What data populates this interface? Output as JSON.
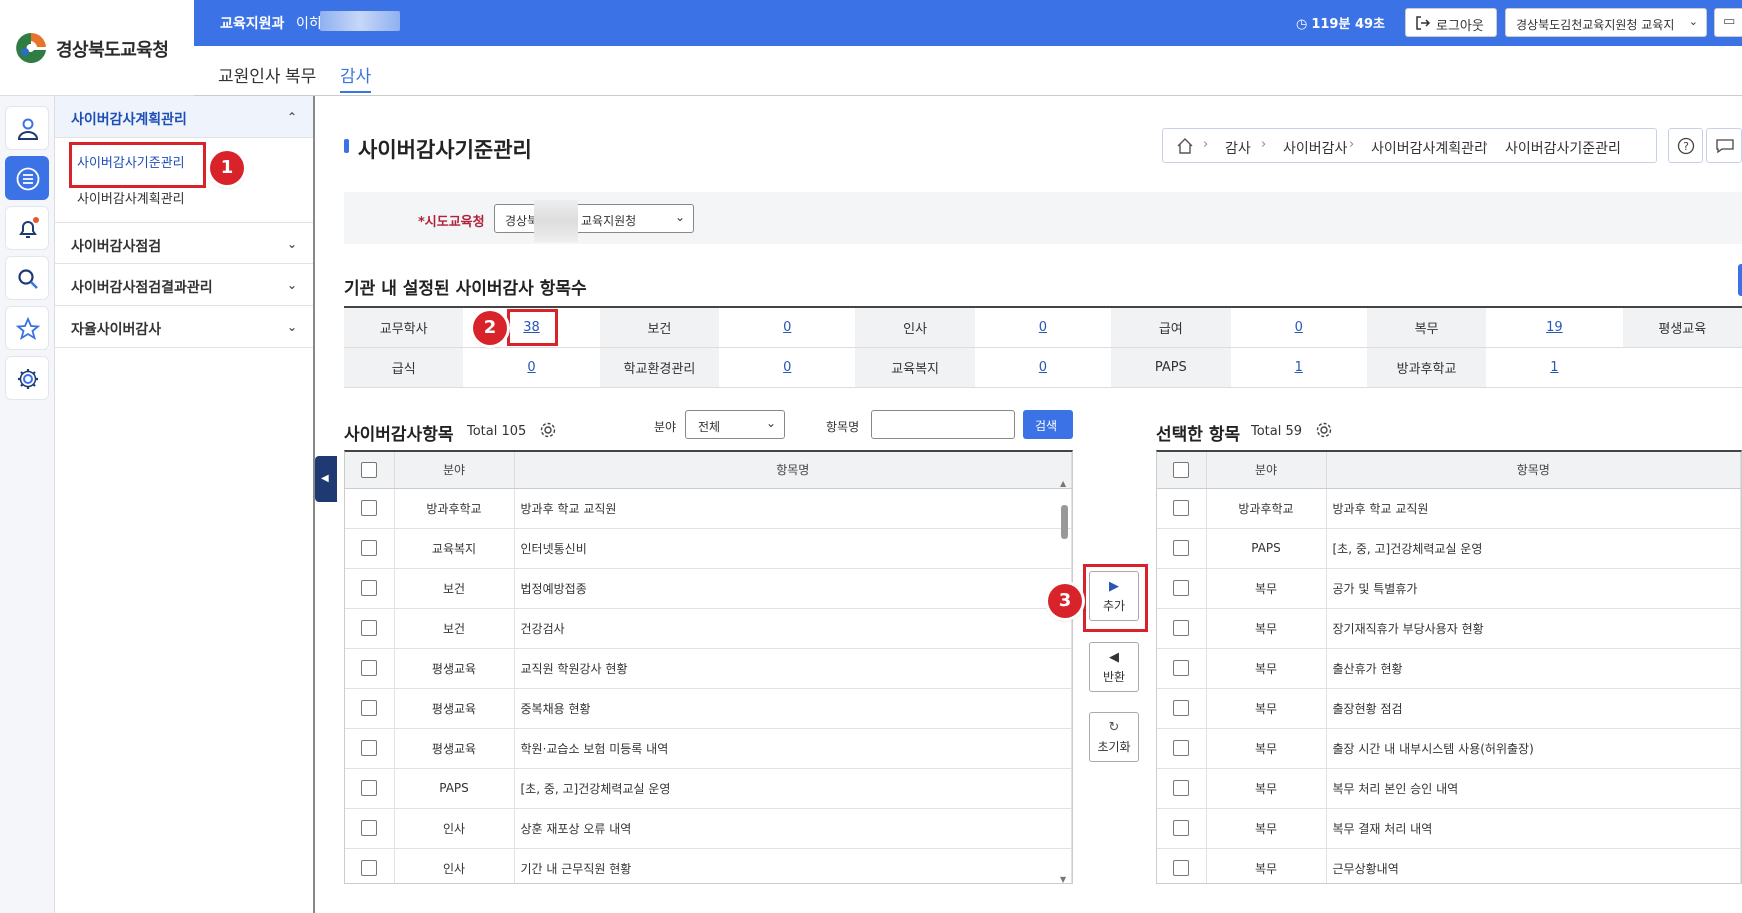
{
  "header": {
    "logo_text": "경상북도교육청",
    "dept": "교육지원과",
    "user_name": "이히",
    "timer": "119분 49초",
    "logout_label": "로그아웃",
    "org_select": "경상북도김천교육지원청 교육지"
  },
  "top_nav": [
    "교원인사",
    "복무",
    "감사"
  ],
  "side_menu": {
    "plan": {
      "label": "사이버감사계획관리",
      "items": [
        "사이버감사기준관리",
        "사이버감사계획관리"
      ]
    },
    "check": {
      "label": "사이버감사점검"
    },
    "result": {
      "label": "사이버감사점검결과관리"
    },
    "self": {
      "label": "자율사이버감사"
    }
  },
  "page": {
    "title": "사이버감사기준관리",
    "breadcrumb": [
      "감사",
      "사이버감사",
      "사이버감사계획관리",
      "사이버감사기준관리"
    ]
  },
  "filter": {
    "label": "*시도교육청",
    "value_left": "경상북",
    "value_right": "교육지원청"
  },
  "summary": {
    "title": "기관 내 설정된 사이버감사 항목수",
    "rows": [
      [
        {
          "k": "교무학사",
          "v": "38"
        },
        {
          "k": "보건",
          "v": "0"
        },
        {
          "k": "인사",
          "v": "0"
        },
        {
          "k": "급여",
          "v": "0"
        },
        {
          "k": "복무",
          "v": "19"
        },
        {
          "k": "평생교육",
          "v": ""
        }
      ],
      [
        {
          "k": "급식",
          "v": "0"
        },
        {
          "k": "학교환경관리",
          "v": "0"
        },
        {
          "k": "교육복지",
          "v": "0"
        },
        {
          "k": "PAPS",
          "v": "1"
        },
        {
          "k": "방과후학교",
          "v": "1"
        },
        {
          "k": "",
          "v": ""
        }
      ]
    ]
  },
  "left_panel": {
    "title": "사이버감사항목",
    "total": "Total 105",
    "field_label": "분야",
    "field_value": "전체",
    "item_label": "항목명",
    "item_value": "",
    "search_label": "검색",
    "col_field": "분야",
    "col_name": "항목명",
    "rows": [
      {
        "field": "방과후학교",
        "name": "방과후 학교 교직원"
      },
      {
        "field": "교육복지",
        "name": "인터넷통신비"
      },
      {
        "field": "보건",
        "name": "법정예방접종"
      },
      {
        "field": "보건",
        "name": "건강검사"
      },
      {
        "field": "평생교육",
        "name": "교직원 학원강사 현황"
      },
      {
        "field": "평생교육",
        "name": "중복채용 현황"
      },
      {
        "field": "평생교육",
        "name": "학원·교습소 보험 미등록 내역"
      },
      {
        "field": "PAPS",
        "name": "[초, 중, 고]건강체력교실 운영"
      },
      {
        "field": "인사",
        "name": "상훈 재포상 오류 내역"
      },
      {
        "field": "인사",
        "name": "기간 내 근무직원 현황"
      }
    ]
  },
  "right_panel": {
    "title": "선택한 항목",
    "total": "Total 59",
    "col_field": "분야",
    "col_name": "항목명",
    "rows": [
      {
        "field": "방과후학교",
        "name": "방과후 학교 교직원"
      },
      {
        "field": "PAPS",
        "name": "[초, 중, 고]건강체력교실 운영"
      },
      {
        "field": "복무",
        "name": "공가 및 특별휴가"
      },
      {
        "field": "복무",
        "name": "장기재직휴가 부당사용자 현황"
      },
      {
        "field": "복무",
        "name": "출산휴가 현황"
      },
      {
        "field": "복무",
        "name": "출장현황 점검"
      },
      {
        "field": "복무",
        "name": "출장 시간 내 내부시스템 사용(허위출장)"
      },
      {
        "field": "복무",
        "name": "복무 처리 본인 승인 내역"
      },
      {
        "field": "복무",
        "name": "복무 결재 처리 내역"
      },
      {
        "field": "복무",
        "name": "근무상황내역"
      }
    ]
  },
  "move_buttons": {
    "add": "추가",
    "remove": "반환",
    "reset": "초기화"
  },
  "annotations": [
    "1",
    "2",
    "3"
  ],
  "colors": {
    "primary": "#3b73e6",
    "annotation": "#d8232a",
    "link": "#2a56b8"
  }
}
